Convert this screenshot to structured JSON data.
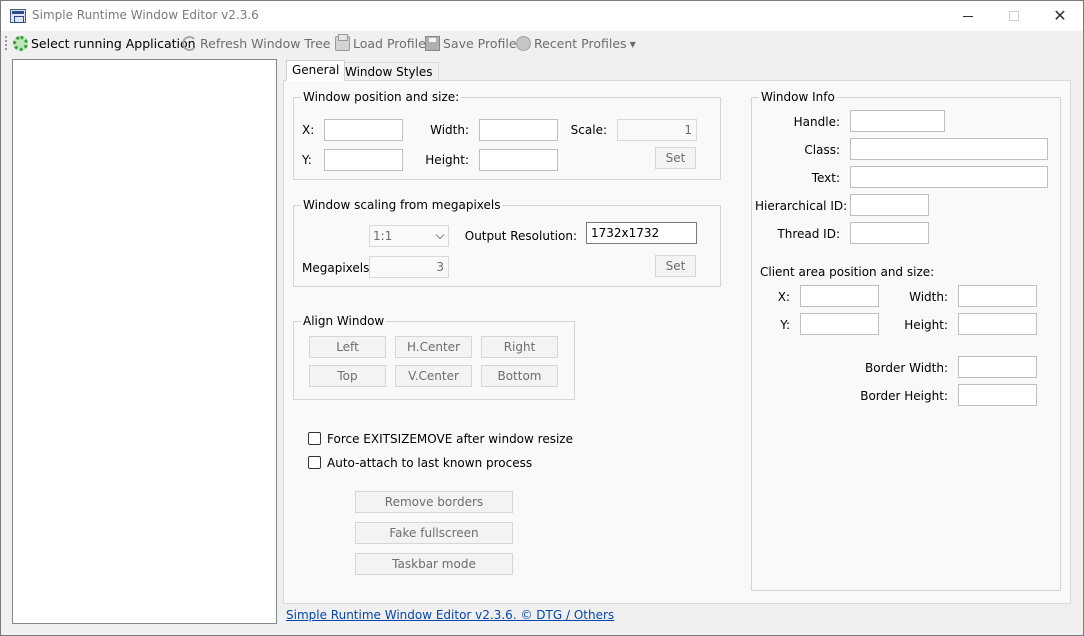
{
  "window": {
    "title": "Simple Runtime Window Editor v2.3.6",
    "minimize": "—",
    "close": "✕"
  },
  "toolbar": {
    "select_app": "Select running Application",
    "refresh": "Refresh Window Tree",
    "load_profile": "Load Profile",
    "save_profile": "Save Profile",
    "recent_profiles": "Recent Profiles",
    "dropdown_caret": "▼"
  },
  "tabs": [
    "General",
    "Window Styles"
  ],
  "position_group": {
    "title": "Window position and size:",
    "x_label": "X:",
    "y_label": "Y:",
    "width_label": "Width:",
    "height_label": "Height:",
    "scale_label": "Scale:",
    "x_value": "",
    "y_value": "",
    "width_value": "",
    "height_value": "",
    "scale_value": "1",
    "set_label": "Set"
  },
  "megapixel_group": {
    "title": "Window scaling from megapixels",
    "ratio_value": "1:1",
    "output_label": "Output Resolution:",
    "output_value": "1732x1732",
    "megapixels_label": "Megapixels:",
    "megapixels_value": "3",
    "set_label": "Set"
  },
  "align_group": {
    "title": "Align Window",
    "left": "Left",
    "hcenter": "H.Center",
    "right": "Right",
    "top": "Top",
    "vcenter": "V.Center",
    "bottom": "Bottom"
  },
  "options": {
    "force_exitsizemove": "Force EXITSIZEMOVE after window resize",
    "auto_attach": "Auto-attach to last known process",
    "force_checked": false,
    "auto_checked": false
  },
  "actions": {
    "remove_borders": "Remove borders",
    "fake_fullscreen": "Fake fullscreen",
    "taskbar_mode": "Taskbar mode"
  },
  "window_info": {
    "title": "Window Info",
    "handle_label": "Handle:",
    "class_label": "Class:",
    "text_label": "Text:",
    "hier_label": "Hierarchical ID:",
    "thread_label": "Thread ID:",
    "client_title": "Client area position and size:",
    "x_label": "X:",
    "y_label": "Y:",
    "width_label": "Width:",
    "height_label": "Height:",
    "border_width_label": "Border Width:",
    "border_height_label": "Border Height:"
  },
  "footer": {
    "link1": "Simple Runtime Window Editor v2.3.6.",
    "copyright": "©",
    "link2": "DTG",
    "link3": "/ Others"
  }
}
